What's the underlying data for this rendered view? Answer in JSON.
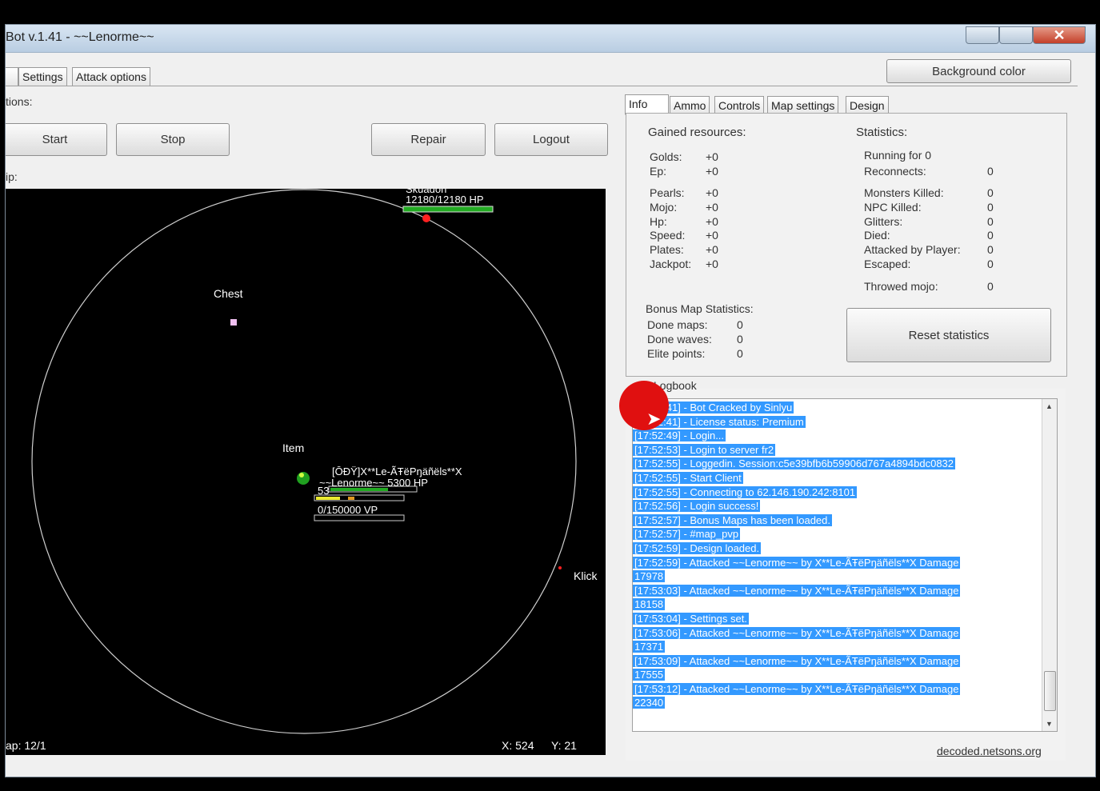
{
  "window": {
    "title": "Bot v.1.41 - ~~Lenorme~~"
  },
  "main_tabs": [
    "Settings",
    "Attack options"
  ],
  "background_color_button": "Background color",
  "options_label": "tions:",
  "buttons": {
    "start": "Start",
    "stop": "Stop",
    "repair": "Repair",
    "logout": "Logout"
  },
  "map_label": "ip:",
  "map": {
    "boss_name": "Skuadon",
    "boss_hp": "12180/12180 HP",
    "chest_label": "Chest",
    "item_label": "Item",
    "player_name": "[ŌĐŸ]X**Le-ÃŦëPŋäñëls**X",
    "player_hp": "~~Lenorme~~  5300 HP",
    "player_level": "53",
    "player_vp": "0/150000 VP",
    "klick_label": "Klick",
    "map_id_label": "ap: 12/1",
    "coord_x": "X: 524",
    "coord_y": "Y: 21"
  },
  "info_tabs": [
    "Info",
    "Ammo",
    "Controls",
    "Map settings",
    "Design"
  ],
  "gained_resources": {
    "title": "Gained resources:",
    "rows": [
      {
        "label": "Golds:",
        "value": "+0"
      },
      {
        "label": "Ep:",
        "value": "+0"
      },
      {
        "label": "Pearls:",
        "value": "+0"
      },
      {
        "label": "Mojo:",
        "value": "+0"
      },
      {
        "label": "Hp:",
        "value": "+0"
      },
      {
        "label": "Speed:",
        "value": "+0"
      },
      {
        "label": "Plates:",
        "value": "+0"
      },
      {
        "label": "Jackpot:",
        "value": "+0"
      }
    ]
  },
  "statistics": {
    "title": "Statistics:",
    "running_for": "Running for 0",
    "rows": [
      {
        "label": "Reconnects:",
        "value": "0"
      },
      {
        "label": "Monsters Killed:",
        "value": "0"
      },
      {
        "label": "NPC Killed:",
        "value": "0"
      },
      {
        "label": "Glitters:",
        "value": "0"
      },
      {
        "label": "Died:",
        "value": "0"
      },
      {
        "label": "Attacked by Player:",
        "value": "0"
      },
      {
        "label": "Escaped:",
        "value": "0"
      },
      {
        "label": "Throwed mojo:",
        "value": "0"
      }
    ]
  },
  "bonus_map": {
    "title": "Bonus Map Statistics:",
    "rows": [
      {
        "label": "Done maps:",
        "value": "0"
      },
      {
        "label": "Done waves:",
        "value": "0"
      },
      {
        "label": "Elite points:",
        "value": "0"
      }
    ]
  },
  "reset_button": "Reset statistics",
  "logbook_label": "Logbook",
  "logs": [
    "[17:52:41] - Bot Cracked by Sinlyu",
    "[17:52:41] - License status: Premium",
    "[17:52:49] - Login...",
    "[17:52:53] - Login to server fr2",
    "[17:52:55] - Loggedin. Session:c5e39bfb6b59906d767a4894bdc0832",
    "[17:52:55] - Start Client",
    "[17:52:55] - Connecting to 62.146.190.242:8101",
    "[17:52:56] - Login success!",
    "[17:52:57] - Bonus Maps has been loaded.",
    "[17:52:57] - #map_pvp",
    "[17:52:59] - Design loaded.",
    "[17:52:59] - Attacked ~~Lenorme~~ by X**Le-ÃŦëPŋäñëls**X Damage",
    "17978",
    "[17:53:03] - Attacked ~~Lenorme~~ by X**Le-ÃŦëPŋäñëls**X Damage",
    "18158",
    "[17:53:04] - Settings set.",
    "[17:53:06] - Attacked ~~Lenorme~~ by X**Le-ÃŦëPŋäñëls**X Damage",
    "17371",
    "[17:53:09] - Attacked ~~Lenorme~~ by X**Le-ÃŦëPŋäñëls**X Damage",
    "17555",
    "[17:53:12] - Attacked ~~Lenorme~~ by X**Le-ÃŦëPŋäñëls**X Damage",
    "22340"
  ],
  "footer_link": "decoded.netsons.org",
  "colors": {
    "selection": "#3399ff",
    "cursor_marker": "#e01010",
    "hp_bar": "#22aa22",
    "boss_dot": "#ff2020"
  }
}
